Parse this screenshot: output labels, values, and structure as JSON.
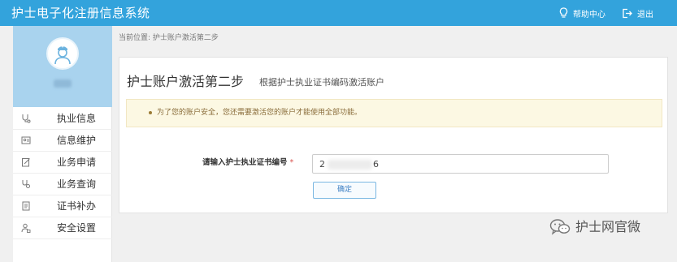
{
  "header": {
    "app_title": "护士电子化注册信息系统",
    "help_label": "帮助中心",
    "logout_label": "退出",
    "bg_color": "#33a3dc"
  },
  "sidebar": {
    "avatar_icon": "nurse-avatar-icon",
    "menu": [
      {
        "label": "执业信息",
        "icon": "stethoscope-icon"
      },
      {
        "label": "信息维护",
        "icon": "id-card-icon"
      },
      {
        "label": "业务申请",
        "icon": "edit-document-icon"
      },
      {
        "label": "业务查询",
        "icon": "search-stethoscope-icon"
      },
      {
        "label": "证书补办",
        "icon": "certificate-icon"
      },
      {
        "label": "安全设置",
        "icon": "lock-user-icon"
      }
    ]
  },
  "breadcrumb": "当前位置: 护士账户激活第二步",
  "main": {
    "title": "护士账户激活第二步",
    "subtitle": "根据护士执业证书编码激活账户",
    "alert_text": "为了您的账户安全，您还需要激活您的账户才能使用全部功能。",
    "form": {
      "label": "请输入护士执业证书编号",
      "required_mark": "*",
      "value_start": "2",
      "value_end": "6"
    },
    "confirm_label": "确定"
  },
  "watermark": {
    "text": "护士网官微",
    "icon": "wechat-icon"
  }
}
